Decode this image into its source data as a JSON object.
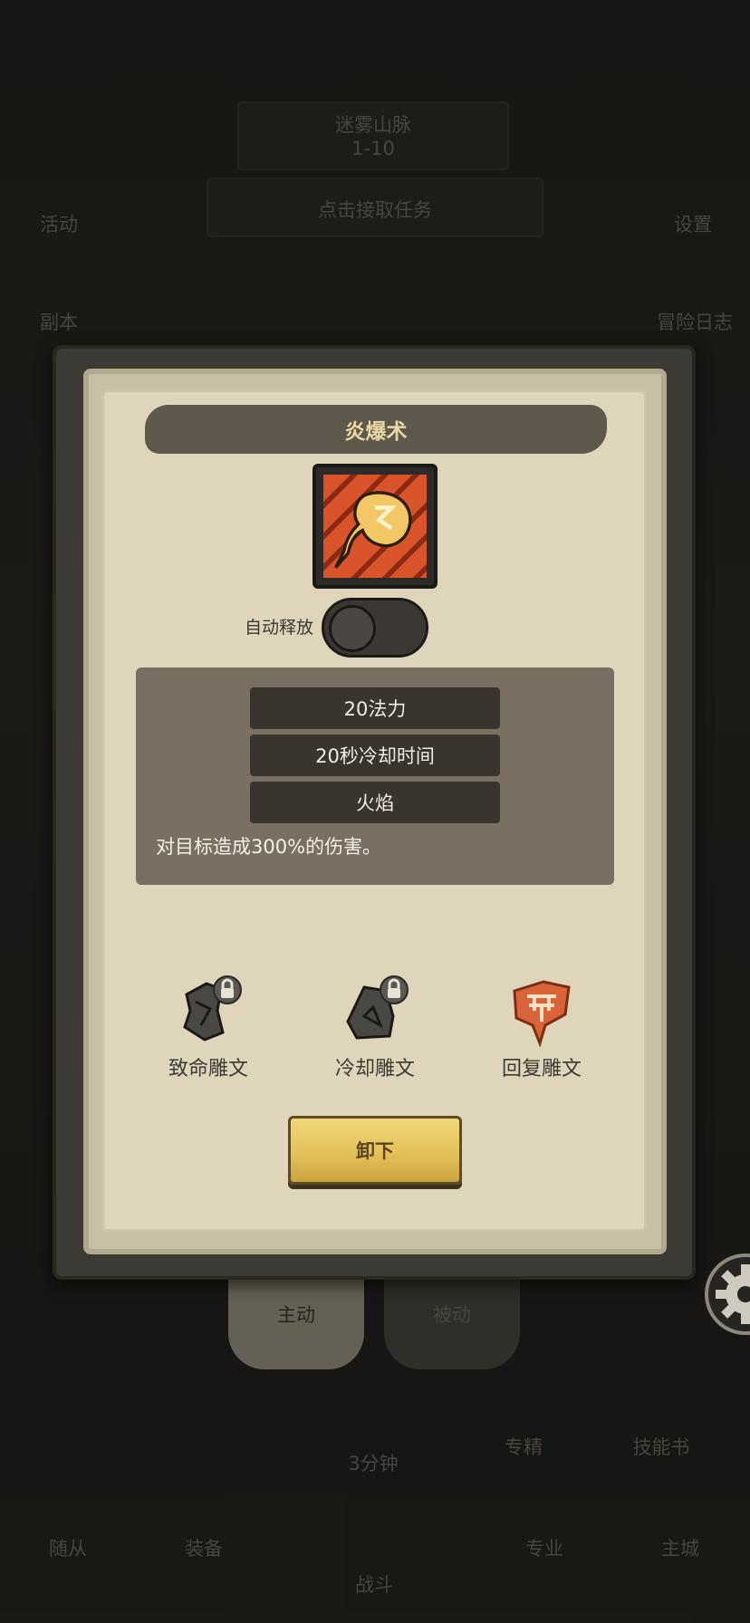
{
  "background": {
    "region_name": "迷雾山脉",
    "region_level": "1-10",
    "quest_prompt": "点击接取任务",
    "left_menu": [
      "活动",
      "副本"
    ],
    "right_menu": [
      "设置",
      "冒险日志"
    ],
    "skill_tabs": [
      "主动",
      "被动"
    ],
    "skill_slots": [
      "专精",
      "技能书"
    ],
    "timer": "3分钟",
    "bottom_nav": [
      "随从",
      "装备",
      "战斗",
      "专业",
      "主城"
    ]
  },
  "dialog": {
    "title": "炎爆术",
    "skill_icon": "fireball-icon",
    "auto_cast_label": "自动释放",
    "auto_cast_on": false,
    "stats": [
      "20法力",
      "20秒冷却时间",
      "火焰"
    ],
    "description": "对目标造成300%的伤害。",
    "runes": [
      {
        "label": "致命雕文",
        "icon": "fatal-rune-icon",
        "locked": true
      },
      {
        "label": "冷却雕文",
        "icon": "cooldown-rune-icon",
        "locked": true
      },
      {
        "label": "回复雕文",
        "icon": "recovery-rune-icon",
        "locked": false
      }
    ],
    "unequip_label": "卸下"
  },
  "colors": {
    "accent_gold": "#e2bf55",
    "title_text": "#ead8a4",
    "rune_orange": "#d9643a"
  }
}
